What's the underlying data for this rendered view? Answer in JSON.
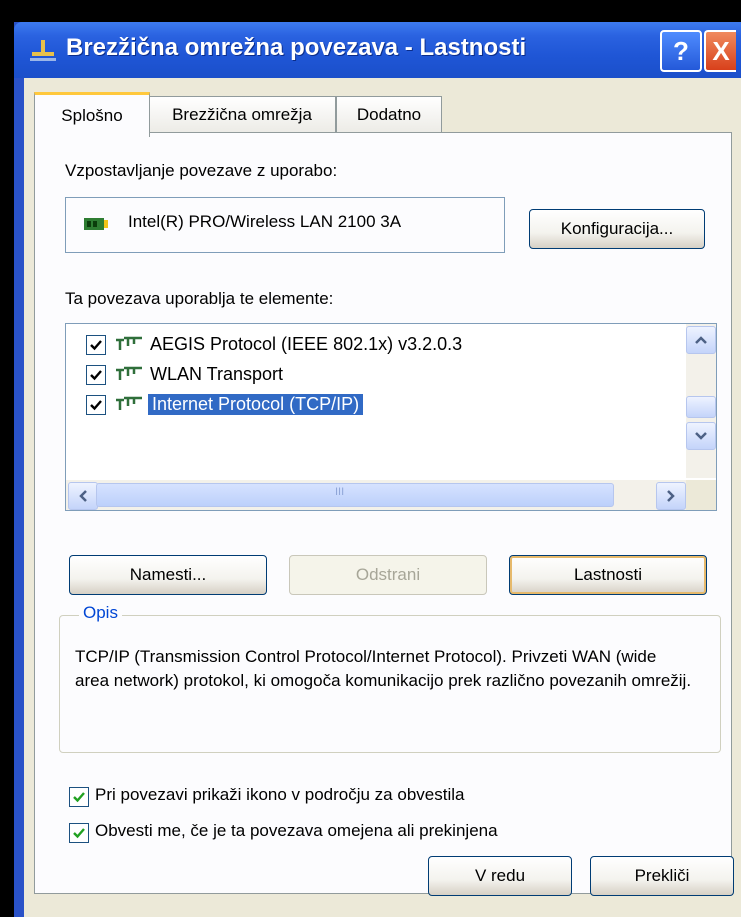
{
  "window": {
    "title": "Brezžična omrežna povezava - Lastnosti",
    "help_label": "?",
    "close_label": "X"
  },
  "tabs": [
    {
      "label": "Splošno",
      "active": true
    },
    {
      "label": "Brezžična omrežja",
      "active": false
    },
    {
      "label": "Dodatno",
      "active": false
    }
  ],
  "connect_using": {
    "label": "Vzpostavljanje povezave z uporabo:",
    "device": "Intel(R) PRO/Wireless LAN 2100 3A",
    "configure_button": "Konfiguracija..."
  },
  "components": {
    "label": "Ta povezava uporablja te elemente:",
    "items": [
      {
        "label": "AEGIS Protocol (IEEE 802.1x) v3.2.0.3",
        "checked": true,
        "selected": false
      },
      {
        "label": "WLAN Transport",
        "checked": true,
        "selected": false
      },
      {
        "label": "Internet Protocol (TCP/IP)",
        "checked": true,
        "selected": true
      }
    ],
    "hscroll_grip": "III"
  },
  "buttons": {
    "install": "Namesti...",
    "uninstall": "Odstrani",
    "properties": "Lastnosti"
  },
  "description": {
    "group_title": "Opis",
    "text": "TCP/IP (Transmission Control Protocol/Internet Protocol). Privzeti WAN (wide area network) protokol, ki omogoča komunikacijo prek različno povezanih omrežij."
  },
  "options": [
    {
      "label": "Pri povezavi prikaži ikono v področju za obvestila",
      "checked": true
    },
    {
      "label": "Obvesti me, če je ta povezava omejena ali prekinjena",
      "checked": true
    }
  ],
  "footer": {
    "ok": "V redu",
    "cancel": "Prekliči"
  },
  "colors": {
    "title_bar": "#2a62e0",
    "selection": "#316ac5",
    "group_title": "#0046d5",
    "dialog_bg": "#ece9d8"
  },
  "icons": {
    "title": "network-connection-icon",
    "device": "network-card-icon",
    "protocol": "protocol-icon"
  }
}
